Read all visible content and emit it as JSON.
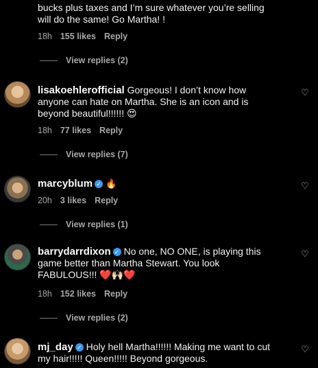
{
  "comments": [
    {
      "id": "c0",
      "text": "bucks plus taxes and I’m sure whatever you’re selling will do the same! Go Martha! !",
      "time": "18h",
      "likes": "155 likes",
      "reply_label": "Reply",
      "view_replies": "View replies (2)"
    },
    {
      "id": "c1",
      "username": "lisakoehlerofficial",
      "verified": false,
      "text": "Gorgeous! I don’t know how anyone can hate on Martha. She is an icon and is beyond beautiful!!!!!! 😍",
      "time": "18h",
      "likes": "77 likes",
      "reply_label": "Reply",
      "view_replies": "View replies (7)"
    },
    {
      "id": "c2",
      "username": "marcyblum",
      "verified": true,
      "text": "🔥",
      "time": "20h",
      "likes": "3 likes",
      "reply_label": "Reply",
      "view_replies": "View replies (1)"
    },
    {
      "id": "c3",
      "username": "barrydarrdixon",
      "verified": true,
      "text": "No one, NO ONE, is playing this game better than Martha Stewart. You look FABULOUS!!! ❤️🙌🏻❤️",
      "time": "18h",
      "likes": "152 likes",
      "reply_label": "Reply",
      "view_replies": "View replies (2)"
    },
    {
      "id": "c4",
      "username": "mj_day",
      "verified": true,
      "text": "Holy hell Martha!!!!!! Making me want to cut my hair!!!!! Queen!!!!! Beyond gorgeous."
    }
  ],
  "icons": {
    "heart": "heart-icon",
    "verified": "verified-badge-icon"
  },
  "colors": {
    "background": "#000000",
    "text": "#f5f5f5",
    "muted": "#a8a8a8",
    "verified": "#3897f0"
  }
}
